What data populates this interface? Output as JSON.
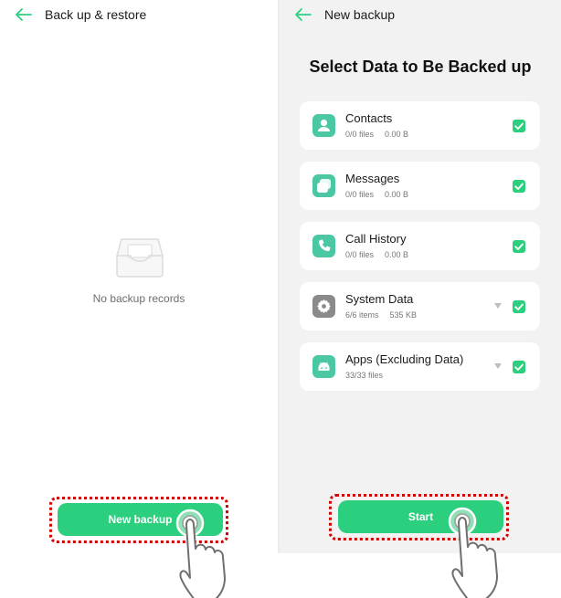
{
  "left_screen": {
    "title": "Back up & restore",
    "empty_state": "No backup records",
    "primary_button": "New backup"
  },
  "right_screen": {
    "title": "New backup",
    "heading": "Select Data to Be Backed up",
    "categories": [
      {
        "name": "Contacts",
        "count": "0/0 files",
        "size": "0.00 B",
        "icon": "contact-icon",
        "checked": true
      },
      {
        "name": "Messages",
        "count": "0/0 files",
        "size": "0.00 B",
        "icon": "messages-icon",
        "checked": true
      },
      {
        "name": "Call History",
        "count": "0/0 files",
        "size": "0.00 B",
        "icon": "phone-icon",
        "checked": true
      },
      {
        "name": "System Data",
        "count": "6/6 items",
        "size": "535 KB",
        "icon": "settings-icon",
        "checked": true
      },
      {
        "name": "Apps (Excluding Data)",
        "count": "33/33 files",
        "icon": "android-icon",
        "checked": true
      }
    ],
    "primary_button": "Start"
  },
  "colors": {
    "accent": "#2ccf7e",
    "highlight_frame": "#d10000",
    "icon_teal": "#4cc7a3",
    "icon_gray": "#8a8a8a"
  }
}
